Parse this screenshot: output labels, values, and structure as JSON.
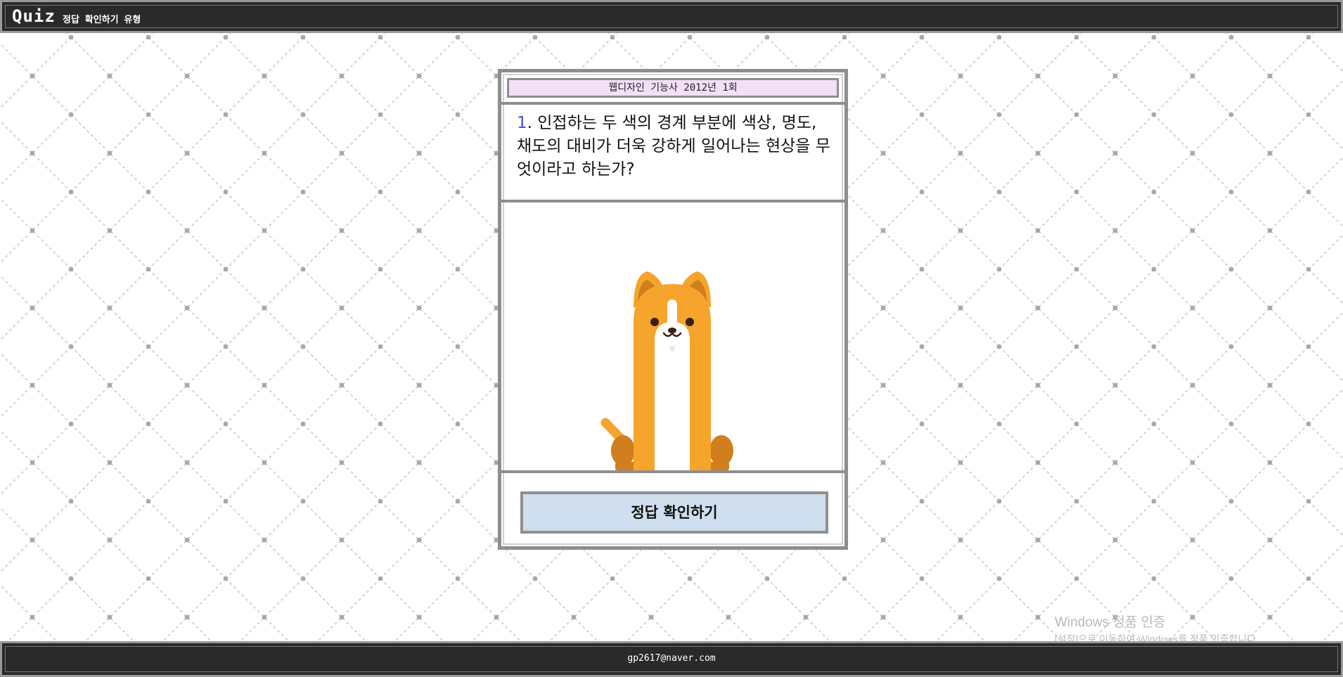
{
  "header": {
    "logo": "Quiz",
    "subtitle": "정답 확인하기 유형"
  },
  "quiz": {
    "exam_label": "웹디자인 기능사 2012년 1회",
    "question_number": "1",
    "question_text": ". 인접하는 두 색의 경계 부분에 색상, 명도, 채도의 대비가 더욱 강하게 일어나는 현상을 무엇이라고 하는가?",
    "answer_button_label": "정답 확인하기"
  },
  "footer": {
    "email": "gp2617@naver.com"
  },
  "watermark": {
    "line1": "Windows 정품 인증",
    "line2": "[설정]으로 이동하여 Windows를 정품 인증합니다."
  },
  "colors": {
    "bar_bg": "#2a2a2a",
    "frame_gray": "#8e8e8e",
    "title_bg": "#f3e0f7",
    "button_bg": "#cfdff0",
    "question_number": "#3b4fd8",
    "dog_orange": "#f6a42b",
    "dog_dark_orange": "#d07e1e"
  }
}
